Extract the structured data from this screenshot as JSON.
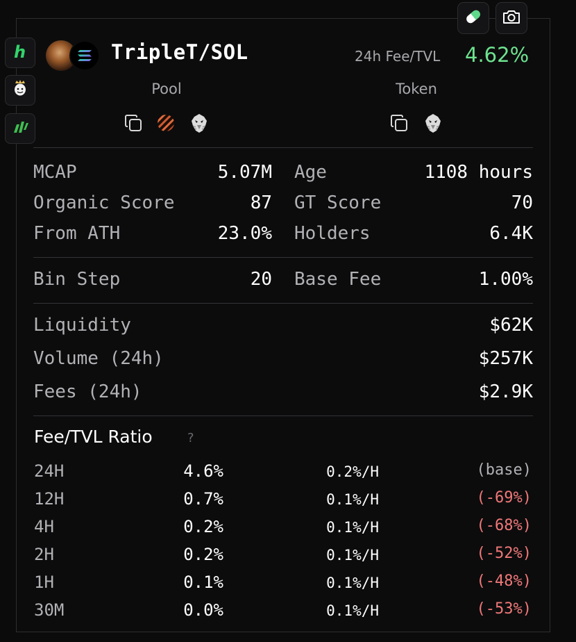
{
  "header": {
    "pair_name": "TripleT/SOL",
    "fee_tvl_label": "24h Fee/TVL",
    "fee_tvl_value": "4.62%",
    "fee_tvl_color": "#6ee38f",
    "pool_label": "Pool",
    "token_label": "Token"
  },
  "icons": {
    "side": [
      "hyperliquid-h-icon",
      "crowned-avatar-icon",
      "green-stripes-logo-icon"
    ],
    "top": [
      "pill-icon",
      "camera-icon"
    ],
    "pool_links": [
      "copy-icon",
      "striped-orb-icon",
      "eagle-icon"
    ],
    "token_links": [
      "copy-icon",
      "eagle-icon"
    ]
  },
  "stats": {
    "mcap_label": "MCAP",
    "mcap_value": "5.07M",
    "age_label": "Age",
    "age_value": "1108 hours",
    "organic_label": "Organic Score",
    "organic_value": "87",
    "gt_label": "GT Score",
    "gt_value": "70",
    "ath_label": "From ATH",
    "ath_value": "23.0%",
    "holders_label": "Holders",
    "holders_value": "6.4K",
    "binstep_label": "Bin Step",
    "binstep_value": "20",
    "basefee_label": "Base Fee",
    "basefee_value": "1.00%",
    "liquidity_label": "Liquidity",
    "liquidity_value": "$62K",
    "volume_label": "Volume (24h)",
    "volume_value": "$257K",
    "fees_label": "Fees (24h)",
    "fees_value": "$2.9K"
  },
  "ratio": {
    "title": "Fee/TVL Ratio",
    "help": "?",
    "neutral_color": "#b2b2b6",
    "negative_color": "#f07878",
    "rows": [
      {
        "period": "24H",
        "pct": "4.6%",
        "per_hour": "0.2%/H",
        "change": "(base)"
      },
      {
        "period": "12H",
        "pct": "0.7%",
        "per_hour": "0.1%/H",
        "change": "(-69%)"
      },
      {
        "period": "4H",
        "pct": "0.2%",
        "per_hour": "0.1%/H",
        "change": "(-68%)"
      },
      {
        "period": "2H",
        "pct": "0.2%",
        "per_hour": "0.1%/H",
        "change": "(-52%)"
      },
      {
        "period": "1H",
        "pct": "0.1%",
        "per_hour": "0.1%/H",
        "change": "(-48%)"
      },
      {
        "period": "30M",
        "pct": "0.0%",
        "per_hour": "0.1%/H",
        "change": "(-53%)"
      }
    ]
  }
}
